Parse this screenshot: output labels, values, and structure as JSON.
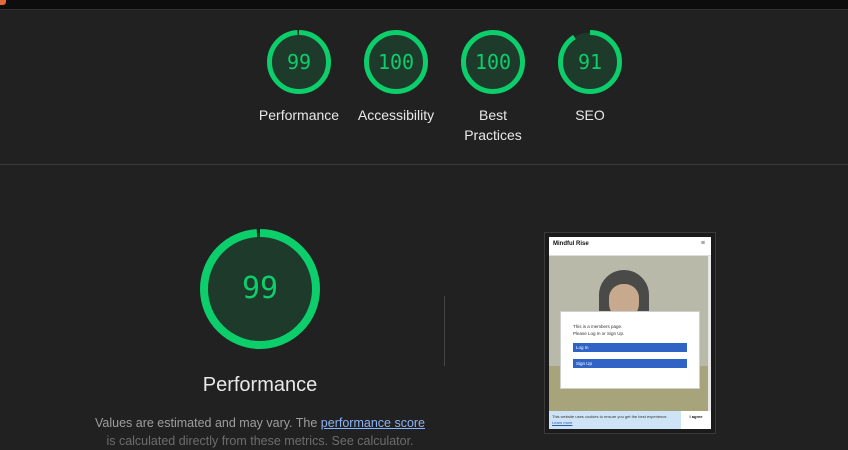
{
  "colors": {
    "pass": "#0cce6b",
    "pass_bg": "#1e3a2a",
    "accent_link": "#8ab4f8"
  },
  "summary": {
    "gauges": [
      {
        "score": "99",
        "label": "Performance",
        "fraction": 0.99
      },
      {
        "score": "100",
        "label": "Accessibility",
        "fraction": 1.0
      },
      {
        "score": "100",
        "label": "Best Practices",
        "fraction": 1.0
      },
      {
        "score": "91",
        "label": "SEO",
        "fraction": 0.91
      }
    ]
  },
  "detail": {
    "score": "99",
    "fraction": 0.99,
    "title": "Performance",
    "note_prefix": "Values are estimated and may vary. The ",
    "note_link": "performance score",
    "note_rest": "is calculated directly from these metrics. See calculator."
  },
  "screenshot": {
    "brand": "Mindful Rise",
    "menu_icon": "hamburger-icon",
    "modal_line1": "This is a members page.",
    "modal_line2": "Please Log In or Sign Up.",
    "login_button": "Log In",
    "signup_button": "Sign Up",
    "cookie_text": "This website uses cookies to ensure you get the best experience.",
    "cookie_link": "Learn more",
    "agree_button": "I agree"
  }
}
